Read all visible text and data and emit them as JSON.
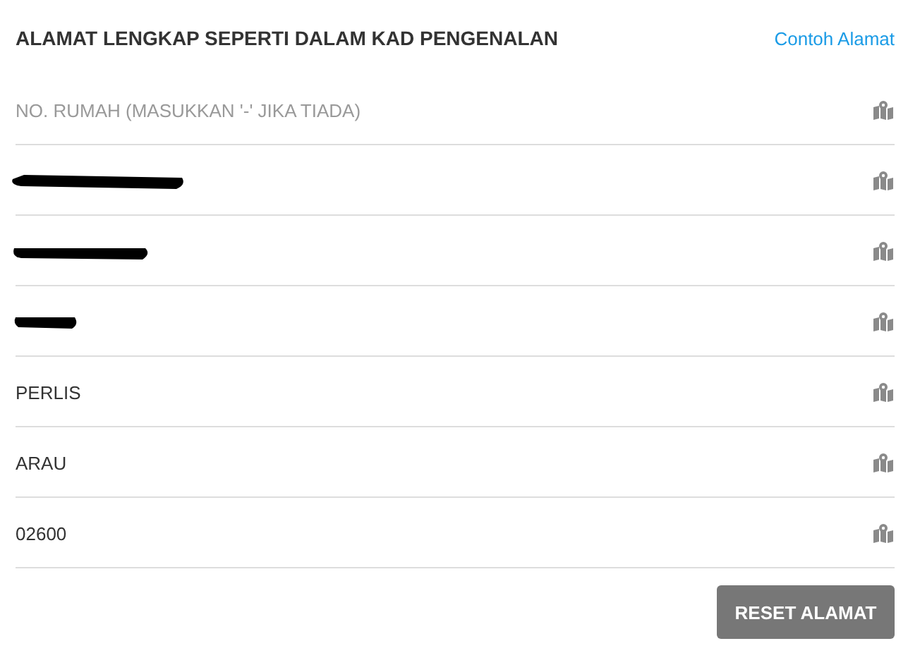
{
  "heading": "ALAMAT LENGKAP SEPERTI DALAM KAD PENGENALAN",
  "example_link": "Contoh Alamat",
  "fields": [
    {
      "kind": "empty",
      "placeholder": "NO. RUMAH (MASUKKAN '-' JIKA TIADA)"
    },
    {
      "kind": "redacted"
    },
    {
      "kind": "redacted"
    },
    {
      "kind": "redacted"
    },
    {
      "kind": "filled",
      "value": "PERLIS"
    },
    {
      "kind": "filled",
      "value": "ARAU"
    },
    {
      "kind": "filled",
      "value": "02600"
    }
  ],
  "reset_button": "RESET ALAMAT"
}
